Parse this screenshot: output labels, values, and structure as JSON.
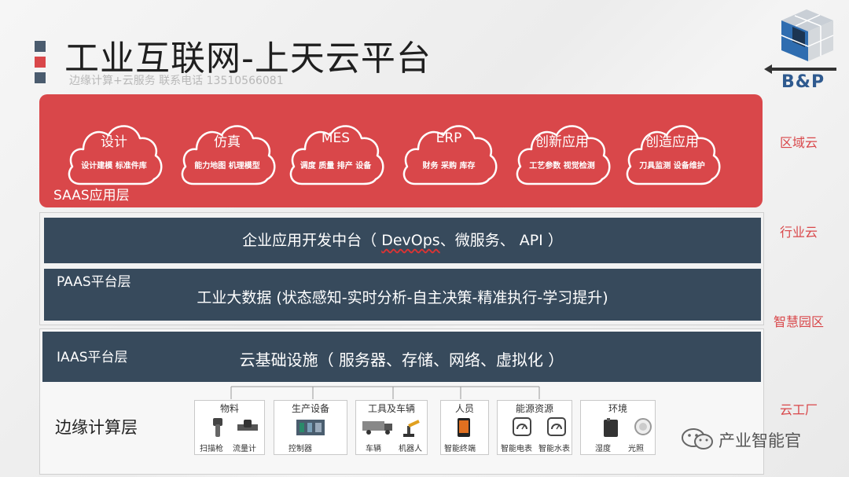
{
  "header": {
    "title": "工业互联网-上天云平台",
    "subtitle": "边缘计算+云服务    联系电话 13510566081",
    "accent_colors": [
      "#4a5b6e",
      "#d9474a",
      "#4a5b6e"
    ]
  },
  "logo": {
    "text": "B&P"
  },
  "saas": {
    "label": "SAAS应用层",
    "clouds": [
      {
        "name": "设计",
        "desc": "设计建模  标准件库"
      },
      {
        "name": "仿真",
        "desc": "能力地图 机理模型"
      },
      {
        "name": "MES",
        "desc": "调度 质量 排产 设备"
      },
      {
        "name": "ERP",
        "desc": "财务  采购  库存"
      },
      {
        "name": "创新应用",
        "desc": "工艺参数  视觉检测"
      },
      {
        "name": "创造应用",
        "desc": "刀具监测  设备维护"
      }
    ]
  },
  "paas": {
    "label": "PAAS平台层",
    "bar1_pre": "企业应用开发中台（ ",
    "bar1_wavy": "DevOps",
    "bar1_post": "、微服务、 API ）",
    "bar2": "工业大数据 (状态感知-实时分析-自主决策-精准执行-学习提升)"
  },
  "iaas": {
    "label": "IAAS平台层",
    "text": "云基础设施（ 服务器、存储、网络、虚拟化 ）"
  },
  "edge": {
    "label": "边缘计算层",
    "groups": [
      {
        "title": "物料",
        "items": [
          "扫描枪",
          "流量计"
        ]
      },
      {
        "title": "生产设备",
        "items": [
          "控制器"
        ]
      },
      {
        "title": "工具及车辆",
        "items": [
          "车辆",
          "机器人"
        ]
      },
      {
        "title": "人员",
        "items": [
          "智能终端"
        ]
      },
      {
        "title": "能源资源",
        "items": [
          "智能电表",
          "智能水表"
        ]
      },
      {
        "title": "环境",
        "items": [
          "湿度",
          "光照"
        ]
      }
    ]
  },
  "side_labels": [
    "区域云",
    "行业云",
    "智慧园区",
    "云工厂"
  ],
  "watermark": "产业智能官",
  "colors": {
    "red": "#d9474a",
    "navy": "#374a5c"
  }
}
